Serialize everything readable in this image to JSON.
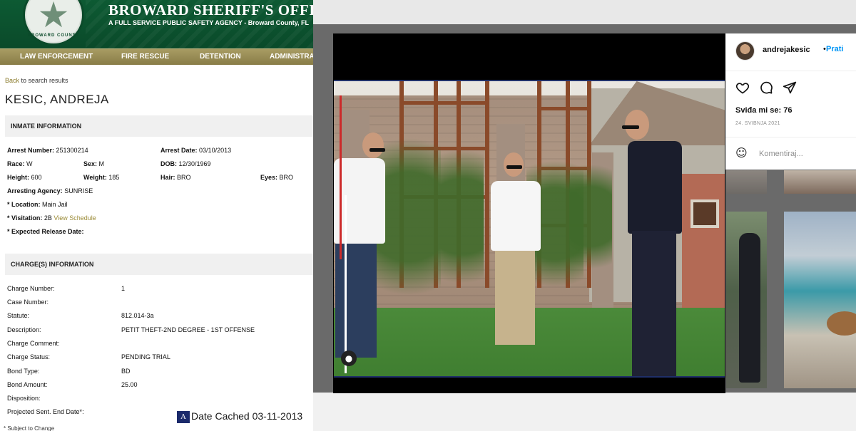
{
  "sheriff": {
    "title": "BROWARD SHERIFF'S OFFICE",
    "subtitle": "A FULL SERVICE PUBLIC SAFETY AGENCY - Broward County, FL",
    "seal_text": "BROWARD COUNTY",
    "nav": [
      "LAW ENFORCEMENT",
      "FIRE RESCUE",
      "DETENTION",
      "ADMINISTRA"
    ],
    "back_link": "Back",
    "back_suffix": "to search results",
    "inmate_name": "KESIC, ANDREJA",
    "inmate_section": "INMATE INFORMATION",
    "charges_section": "CHARGE(S) INFORMATION",
    "inmate": {
      "arrest_number_label": "Arrest Number:",
      "arrest_number": "251300214",
      "arrest_date_label": "Arrest Date:",
      "arrest_date": "03/10/2013",
      "race_label": "Race:",
      "race": "W",
      "sex_label": "Sex:",
      "sex": "M",
      "dob_label": "DOB:",
      "dob": "12/30/1969",
      "height_label": "Height:",
      "height": "600",
      "weight_label": "Weight:",
      "weight": "185",
      "hair_label": "Hair:",
      "hair": "BRO",
      "eyes_label": "Eyes:",
      "eyes": "BRO",
      "agency_label": "Arresting Agency:",
      "agency": "SUNRISE",
      "location_label": "* Location:",
      "location": "Main Jail",
      "visitation_label": "* Visitation:",
      "visitation": "2B",
      "view_schedule": "View Schedule",
      "release_label": "* Expected Release Date:"
    },
    "charges": [
      {
        "label": "Charge Number:",
        "value": "1"
      },
      {
        "label": "Case Number:",
        "value": ""
      },
      {
        "label": "Statute:",
        "value": "812.014-3a"
      },
      {
        "label": "Description:",
        "value": "PETIT THEFT-2ND DEGREE - 1ST OFFENSE"
      },
      {
        "label": "Charge Comment:",
        "value": ""
      },
      {
        "label": "Charge Status:",
        "value": "PENDING TRIAL"
      },
      {
        "label": "Bond Type:",
        "value": "BD"
      },
      {
        "label": "Bond Amount:",
        "value": "25.00"
      },
      {
        "label": "Disposition:",
        "value": ""
      },
      {
        "label": "Projected Sent. End Date*:",
        "value": ""
      }
    ],
    "cached_icon": "A",
    "cached_text": "Date Cached 03-11-2013",
    "footnote": "* Subject to Change"
  },
  "instagram": {
    "username": "andrejakesic",
    "dot": "•",
    "follow": "Prati",
    "likes": "Sviđa mi se: 76",
    "date": "24. SVIBNJA 2021",
    "comment_placeholder": "Komentiraj...",
    "icons": [
      "heart-icon",
      "comment-icon",
      "share-icon",
      "emoji-icon",
      "avatar-icon"
    ]
  },
  "colors": {
    "sheriff_green": "#0d5a33",
    "nav_gold": "#a89c63",
    "instagram_blue": "#0095f6"
  }
}
